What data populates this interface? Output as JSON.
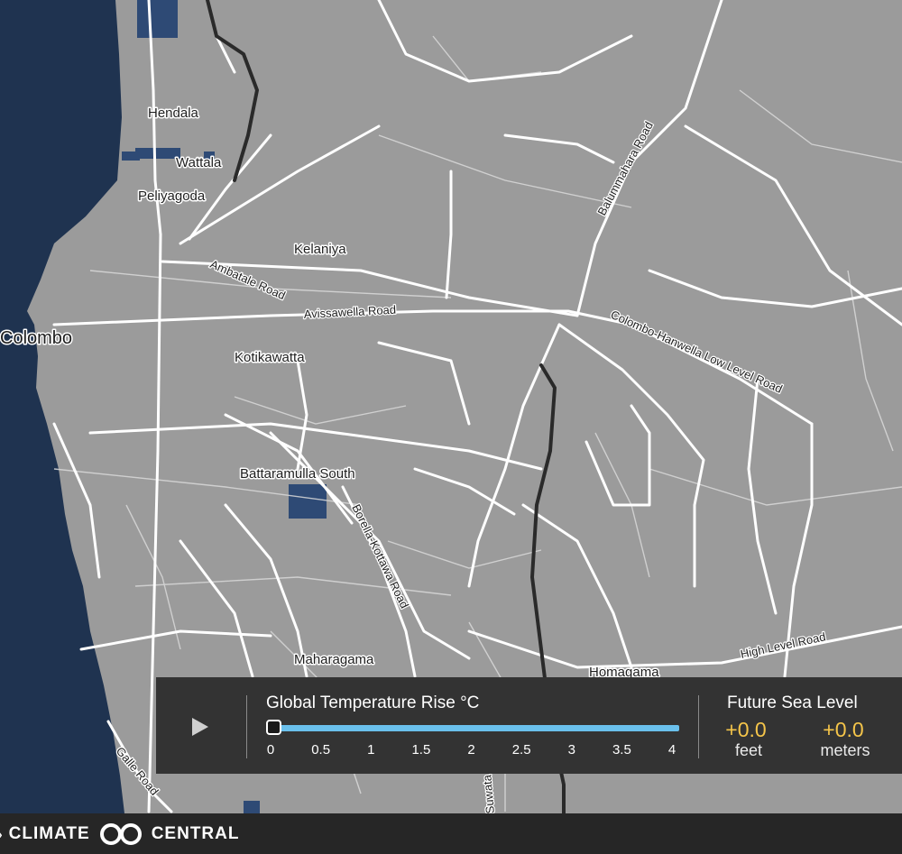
{
  "map": {
    "places": {
      "hendala": "Hendala",
      "wattala": "Wattala",
      "peliyagoda": "Peliyagoda",
      "kelaniya": "Kelaniya",
      "colombo": "Colombo",
      "kotikawatta": "Kotikawatta",
      "battaramulla": "Battaramulla South",
      "maharagama": "Maharagama",
      "homagama": "Homagama"
    },
    "roads": {
      "ambatale": "Ambatale Road",
      "avissawella": "Avissawella Road",
      "balummahara": "Balummahara Road",
      "colombo_hanwella": "Colombo-Hanwella Low Level Road",
      "borella_kottawa": "Borella-Kottawa Road",
      "high_level": "High Level Road",
      "galle": "Galle Road",
      "suwata": "Suwata Road"
    },
    "colors": {
      "land": "#9b9b9b",
      "ocean": "#1f3350",
      "flood": "#2e4a75",
      "road": "#ffffff",
      "highway": "#2a2a2a"
    }
  },
  "panel": {
    "play_icon": "play-icon",
    "temp_title": "Global Temperature Rise °C",
    "ticks": [
      "0",
      "0.5",
      "1",
      "1.5",
      "2",
      "2.5",
      "3",
      "3.5",
      "4"
    ],
    "temperature_value": 0,
    "slider_min": 0,
    "slider_max": 4,
    "sea_title": "Future Sea Level",
    "feet_value": "+0.0",
    "feet_unit": "feet",
    "meters_value": "+0.0",
    "meters_unit": "meters",
    "accent": "#f5c54a",
    "track_color": "#6ac0ec"
  },
  "footer": {
    "logo_left": "CLIMATE",
    "logo_right": "CENTRAL",
    "logo_icon": "infinity-loop-icon"
  }
}
